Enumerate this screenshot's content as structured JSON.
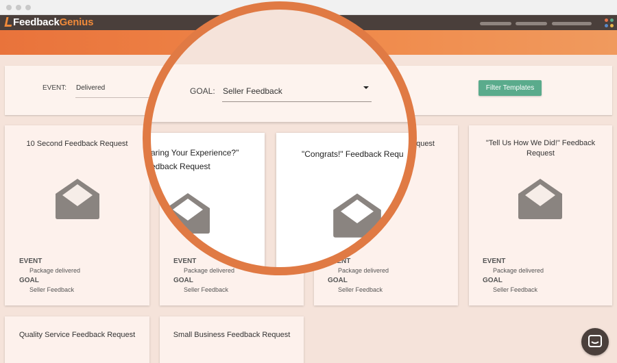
{
  "app": {
    "logo_part1": "Feedback",
    "logo_part2": "Genius"
  },
  "filters": {
    "event_label": "EVENT:",
    "event_value": "Delivered",
    "goal_label": "GOAL:",
    "goal_value": "Seller Feedback",
    "filter_button": "Filter Templates"
  },
  "meta": {
    "event_heading": "EVENT",
    "goal_heading": "GOAL",
    "event_value": "Package delivered",
    "goal_value": "Seller Feedback"
  },
  "cards": [
    {
      "title": "10 Second Feedback Request"
    },
    {
      "title": "...aring Your Experience?\" ...edback Request"
    },
    {
      "title": "...equest"
    },
    {
      "title": "\"Tell Us How We Did!\" Feedback Request"
    },
    {
      "title": "Quality Service Feedback Request"
    },
    {
      "title": "Small Business Feedback Request"
    }
  ],
  "zoom": {
    "goal_label": "GOAL:",
    "goal_value": "Seller Feedback",
    "card_left_title_1": "aring Your Experience?\"",
    "card_left_title_2": "edback Request",
    "card_right_title": "\"Congrats!\" Feedback Requ"
  },
  "colors": {
    "appbar": "#4a3f3b",
    "accent_orange": "#e9733b",
    "filter_button": "#5aab8c",
    "background": "#f5e3da",
    "envelope": "#8a8480"
  },
  "icons": {
    "envelope": "envelope-open-icon",
    "dropdown": "caret-down-icon",
    "chat": "chat-bubble-icon",
    "apps": "apps-grid-icon"
  }
}
